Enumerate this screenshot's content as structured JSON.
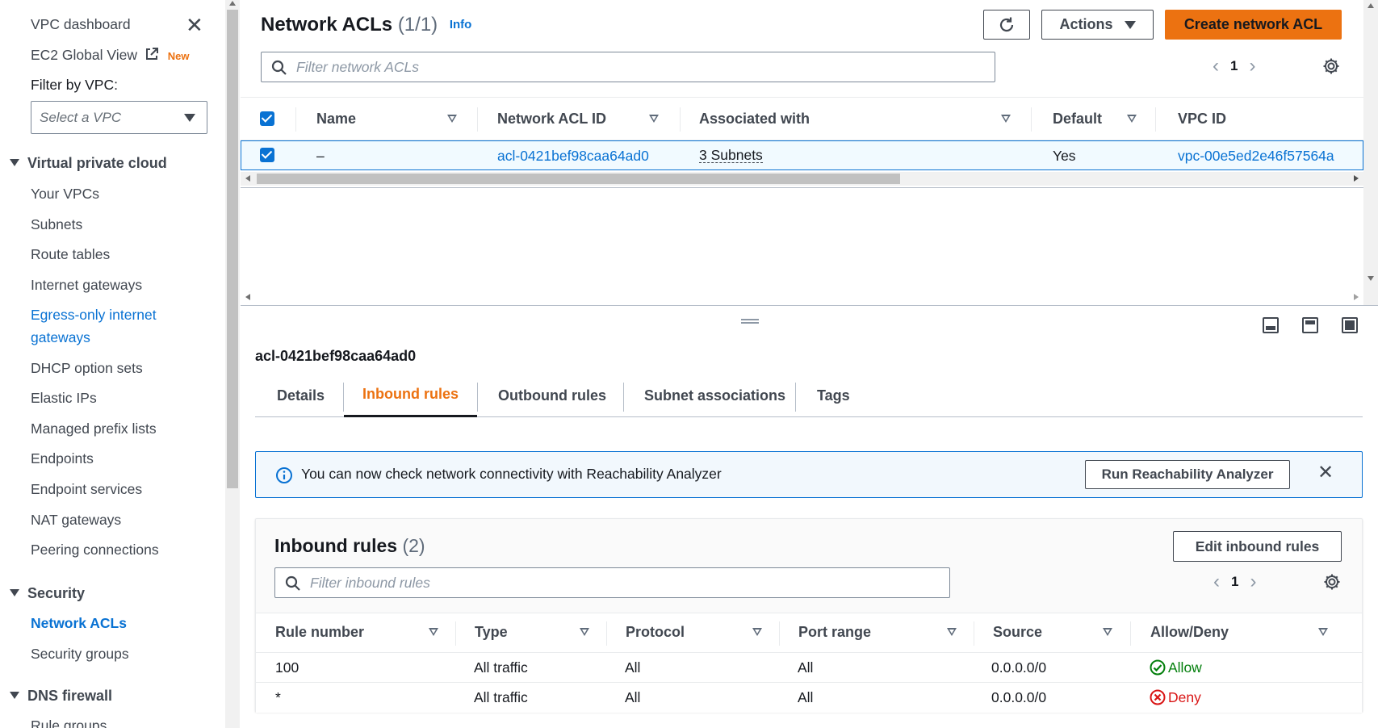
{
  "sidebar": {
    "dashboard": "VPC dashboard",
    "global_view": "EC2 Global View",
    "new_badge": "New",
    "filter_label": "Filter by VPC:",
    "select_placeholder": "Select a VPC",
    "section_vpc": "Virtual private cloud",
    "vpc_items": [
      "Your VPCs",
      "Subnets",
      "Route tables",
      "Internet gateways",
      "Egress-only internet",
      "gateways",
      "DHCP option sets",
      "Elastic IPs",
      "Managed prefix lists",
      "Endpoints",
      "Endpoint services",
      "NAT gateways",
      "Peering connections"
    ],
    "section_security": "Security",
    "security_items": [
      "Network ACLs",
      "Security groups"
    ],
    "section_dns": "DNS firewall",
    "dns_items": [
      "Rule groups"
    ]
  },
  "header": {
    "title": "Network ACLs",
    "count": "(1/1)",
    "info": "Info",
    "actions": "Actions",
    "create": "Create network ACL",
    "filter_placeholder": "Filter network ACLs",
    "page": "1"
  },
  "acl_table": {
    "columns": [
      "Name",
      "Network ACL ID",
      "Associated with",
      "Default",
      "VPC ID"
    ],
    "row": {
      "name": "–",
      "acl_id": "acl-0421bef98caa64ad0",
      "associated": "3 Subnets",
      "default": "Yes",
      "vpc_id": "vpc-00e5ed2e46f57564a"
    }
  },
  "detail": {
    "resource_id": "acl-0421bef98caa64ad0",
    "tabs": [
      "Details",
      "Inbound rules",
      "Outbound rules",
      "Subnet associations",
      "Tags"
    ],
    "active_tab": "Inbound rules",
    "flash_message": "You can now check network connectivity with Reachability Analyzer",
    "flash_button": "Run Reachability Analyzer",
    "rules_title": "Inbound rules",
    "rules_count": "(2)",
    "edit_button": "Edit inbound rules",
    "rules_filter_placeholder": "Filter inbound rules",
    "page": "1",
    "rule_columns": [
      "Rule number",
      "Type",
      "Protocol",
      "Port range",
      "Source",
      "Allow/Deny"
    ],
    "rules": [
      {
        "number": "100",
        "type": "All traffic",
        "protocol": "All",
        "port": "All",
        "source": "0.0.0.0/0",
        "action": "Allow"
      },
      {
        "number": "*",
        "type": "All traffic",
        "protocol": "All",
        "port": "All",
        "source": "0.0.0.0/0",
        "action": "Deny"
      }
    ]
  },
  "colors": {
    "accent": "#ec7211",
    "link": "#0972d3",
    "allow": "#037f0c",
    "deny": "#d91515"
  }
}
